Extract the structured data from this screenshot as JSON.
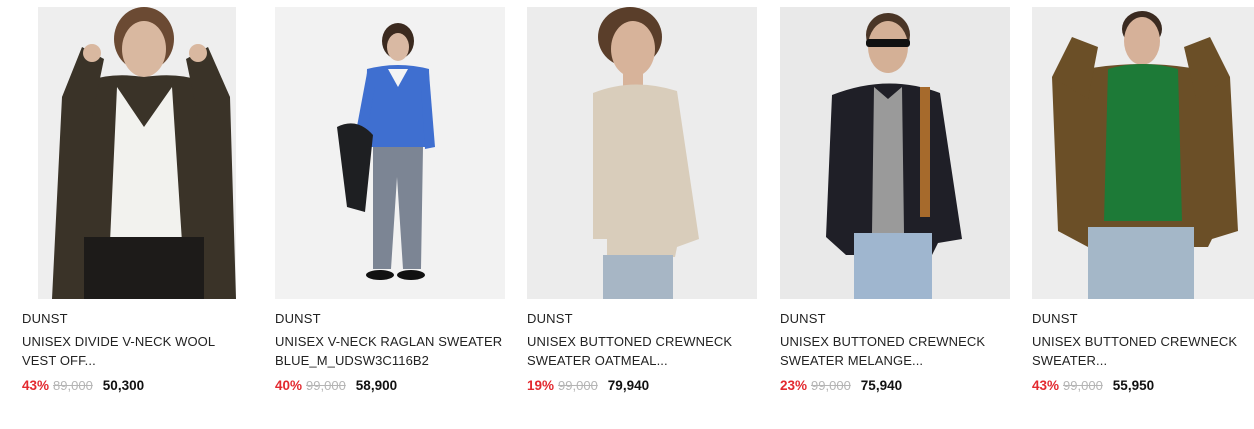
{
  "products": [
    {
      "brand": "DUNST",
      "name": "UNISEX DIVIDE V-NECK WOOL VEST OFF...",
      "discount": "43%",
      "original_price": "89,000",
      "sale_price": "50,300",
      "image": {
        "bg": "#eeeeee",
        "top": "#3a3328",
        "inner": "#f2f2ee",
        "bottom": "#1d1b19",
        "skin": "#d9b8a0",
        "hair": "#6b4a33"
      }
    },
    {
      "brand": "DUNST",
      "name": "UNISEX V-NECK RAGLAN SWEATER BLUE_M_UDSW3C116B2",
      "discount": "40%",
      "original_price": "99,000",
      "sale_price": "58,900",
      "image": {
        "bg": "#f2f2f2",
        "top": "#3f6fd0",
        "inner": "#f4f4f4",
        "bottom": "#7c8594",
        "skin": "#d9b9a3",
        "hair": "#3b2a1f"
      }
    },
    {
      "brand": "DUNST",
      "name": "UNISEX BUTTONED CREWNECK SWEATER OATMEAL...",
      "discount": "19%",
      "original_price": "99,000",
      "sale_price": "79,940",
      "image": {
        "bg": "#ececec",
        "top": "#d9cdbb",
        "inner": "#d9cdbb",
        "bottom": "#a7b6c5",
        "skin": "#d7b39a",
        "hair": "#5a3e2a"
      }
    },
    {
      "brand": "DUNST",
      "name": "UNISEX BUTTONED CREWNECK SWEATER MELANGE...",
      "discount": "23%",
      "original_price": "99,000",
      "sale_price": "75,940",
      "image": {
        "bg": "#e9e9e9",
        "top": "#1f1f27",
        "inner": "#9a9a9a",
        "bottom": "#9fb6cf",
        "skin": "#d4b096",
        "hair": "#4a3526"
      }
    },
    {
      "brand": "DUNST",
      "name": "UNISEX BUTTONED CREWNECK SWEATER...",
      "discount": "43%",
      "original_price": "99,000",
      "sale_price": "55,950",
      "image": {
        "bg": "#ededed",
        "top": "#6b4f27",
        "inner": "#1d7a37",
        "bottom": "#a4b7c8",
        "skin": "#d6b199",
        "hair": "#3a2a20"
      }
    }
  ]
}
